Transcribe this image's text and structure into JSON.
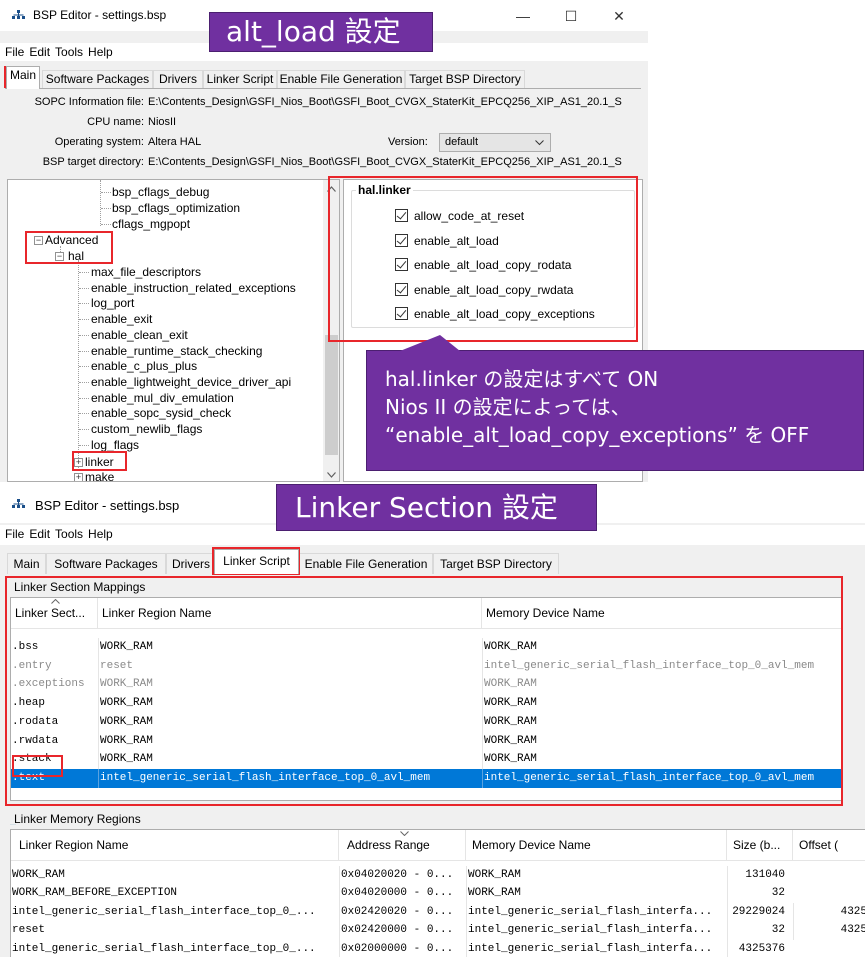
{
  "top_window": {
    "title": "BSP Editor - settings.bsp",
    "menu": [
      "File",
      "Edit",
      "Tools",
      "Help"
    ],
    "window_controls": {
      "minimize": "—",
      "maximize": "☐",
      "close": "✕"
    },
    "tabs": [
      "Main",
      "Software Packages",
      "Drivers",
      "Linker Script",
      "Enable File Generation",
      "Target BSP Directory"
    ],
    "active_tab": "Main",
    "info": {
      "sopc_label": "SOPC Information file:",
      "sopc_value": "E:\\Contents_Design\\GSFI_Nios_Boot\\GSFI_Boot_CVGX_StaterKit_EPCQ256_XIP_AS1_20.1_S",
      "cpu_label": "CPU name:",
      "cpu_value": "NiosII",
      "os_label": "Operating system:",
      "os_value": "Altera HAL",
      "version_label": "Version:",
      "version_value": "default",
      "bsp_dir_label": "BSP target directory:",
      "bsp_dir_value": "E:\\Contents_Design\\GSFI_Nios_Boot\\GSFI_Boot_CVGX_StaterKit_EPCQ256_XIP_AS1_20.1_S"
    },
    "tree": {
      "top_items": [
        "bsp_cflags_debug",
        "bsp_cflags_optimization",
        "cflags_mgpopt"
      ],
      "advanced": "Advanced",
      "hal": "hal",
      "hal_children": [
        "max_file_descriptors",
        "enable_instruction_related_exceptions",
        "log_port",
        "enable_exit",
        "enable_clean_exit",
        "enable_runtime_stack_checking",
        "enable_c_plus_plus",
        "enable_lightweight_device_driver_api",
        "enable_mul_div_emulation",
        "enable_sopc_sysid_check",
        "custom_newlib_flags",
        "log_flags"
      ],
      "linker": "linker",
      "make": "make"
    },
    "hal_linker": {
      "group_title": "hal.linker",
      "options": [
        "allow_code_at_reset",
        "enable_alt_load",
        "enable_alt_load_copy_rodata",
        "enable_alt_load_copy_rwdata",
        "enable_alt_load_copy_exceptions"
      ]
    }
  },
  "callouts": {
    "alt_load_title": "alt_load 設定",
    "note_line1": "hal.linker の設定はすべて ON",
    "note_line2": "Nios II の設定によっては、",
    "note_line3": "“enable_alt_load_copy_exceptions” を OFF",
    "linker_section_title": "Linker Section 設定"
  },
  "bottom_window": {
    "title": "BSP Editor - settings.bsp",
    "menu": [
      "File",
      "Edit",
      "Tools",
      "Help"
    ],
    "tabs": [
      "Main",
      "Software Packages",
      "Drivers",
      "Linker Script",
      "Enable File Generation",
      "Target BSP Directory"
    ],
    "active_tab": "Linker Script",
    "section_mappings": {
      "label": "Linker Section Mappings",
      "columns": [
        "Linker Sect...",
        "Linker Region Name",
        "Memory Device Name"
      ],
      "rows": [
        {
          "section": ".bss",
          "region": "WORK_RAM",
          "device": "WORK_RAM",
          "style": "normal"
        },
        {
          "section": ".entry",
          "region": "reset",
          "device": "intel_generic_serial_flash_interface_top_0_avl_mem",
          "style": "gray"
        },
        {
          "section": ".exceptions",
          "region": "WORK_RAM",
          "device": "WORK_RAM",
          "style": "gray"
        },
        {
          "section": ".heap",
          "region": "WORK_RAM",
          "device": "WORK_RAM",
          "style": "normal"
        },
        {
          "section": ".rodata",
          "region": "WORK_RAM",
          "device": "WORK_RAM",
          "style": "normal"
        },
        {
          "section": ".rwdata",
          "region": "WORK_RAM",
          "device": "WORK_RAM",
          "style": "normal"
        },
        {
          "section": ".stack",
          "region": "WORK_RAM",
          "device": "WORK_RAM",
          "style": "normal"
        },
        {
          "section": ".text",
          "region": "intel_generic_serial_flash_interface_top_0_avl_mem",
          "device": "intel_generic_serial_flash_interface_top_0_avl_mem",
          "style": "selected"
        }
      ]
    },
    "memory_regions": {
      "label": "Linker Memory Regions",
      "columns": [
        "Linker Region Name",
        "Address Range",
        "Memory Device Name",
        "Size (b...",
        "Offset ("
      ],
      "rows": [
        {
          "region": "WORK_RAM",
          "address": "0x04020020 - 0...",
          "device": "WORK_RAM",
          "size": "131040",
          "offset": ""
        },
        {
          "region": "WORK_RAM_BEFORE_EXCEPTION",
          "address": "0x04020000 - 0...",
          "device": "WORK_RAM",
          "size": "32",
          "offset": ""
        },
        {
          "region": "intel_generic_serial_flash_interface_top_0_...",
          "address": "0x02420020 - 0...",
          "device": "intel_generic_serial_flash_interfa...",
          "size": "29229024",
          "offset": "4325"
        },
        {
          "region": "reset",
          "address": "0x02420000 - 0...",
          "device": "intel_generic_serial_flash_interfa...",
          "size": "32",
          "offset": "4325"
        },
        {
          "region": "intel_generic_serial_flash_interface_top_0_...",
          "address": "0x02000000 - 0...",
          "device": "intel_generic_serial_flash_interfa...",
          "size": "4325376",
          "offset": ""
        }
      ]
    }
  },
  "colors": {
    "accent_purple": "#7030a0",
    "highlight_red": "#e8262b",
    "selection_blue": "#0078d7"
  }
}
